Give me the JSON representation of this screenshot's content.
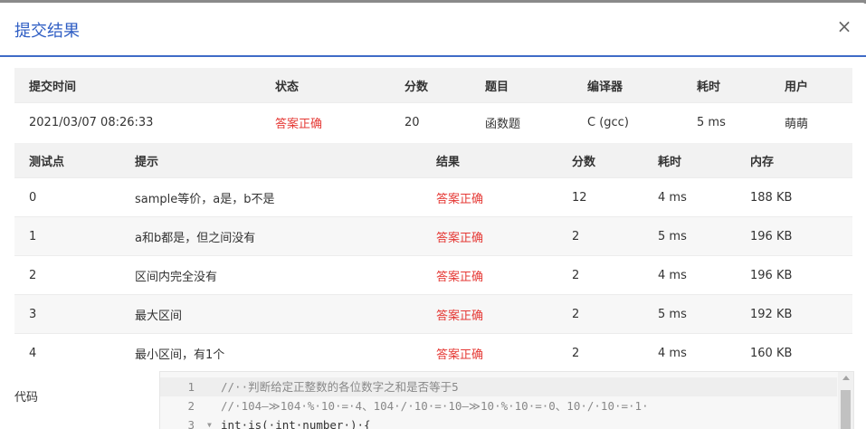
{
  "backdrop": {
    "text": "....."
  },
  "dialog": {
    "title": "提交结果",
    "close_glyph": "×"
  },
  "summary": {
    "headers": [
      "提交时间",
      "状态",
      "分数",
      "题目",
      "编译器",
      "耗时",
      "用户"
    ],
    "row": {
      "time": "2021/03/07 08:26:33",
      "status": "答案正确",
      "score": "20",
      "problem": "函数题",
      "compiler": "C (gcc)",
      "elapsed": "5 ms",
      "user": "萌萌"
    }
  },
  "cases": {
    "headers": [
      "测试点",
      "提示",
      "结果",
      "分数",
      "耗时",
      "内存"
    ],
    "rows": [
      {
        "id": "0",
        "hint": "sample等价，a是，b不是",
        "result": "答案正确",
        "score": "12",
        "time": "4 ms",
        "memory": "188 KB"
      },
      {
        "id": "1",
        "hint": "a和b都是，但之间没有",
        "result": "答案正确",
        "score": "2",
        "time": "5 ms",
        "memory": "196 KB"
      },
      {
        "id": "2",
        "hint": "区间内完全没有",
        "result": "答案正确",
        "score": "2",
        "time": "4 ms",
        "memory": "196 KB"
      },
      {
        "id": "3",
        "hint": "最大区间",
        "result": "答案正确",
        "score": "2",
        "time": "5 ms",
        "memory": "192 KB"
      },
      {
        "id": "4",
        "hint": "最小区间，有1个",
        "result": "答案正确",
        "score": "2",
        "time": "4 ms",
        "memory": "160 KB"
      }
    ]
  },
  "code": {
    "label": "代码",
    "lines": [
      {
        "num": "1",
        "text": "//··判断给定正整数的各位数字之和是否等于5"
      },
      {
        "num": "2",
        "text": "//·104—≫104·%·10·=·4、104·/·10·=·10—≫10·%·10·=·0、10·/·10·=·1·"
      },
      {
        "num": "3",
        "text": "int·is(·int·number·)·{"
      }
    ]
  },
  "colors": {
    "accent": "#2f5ec4",
    "status_ok": "#e53935",
    "header_bg": "#f2f2f2"
  }
}
